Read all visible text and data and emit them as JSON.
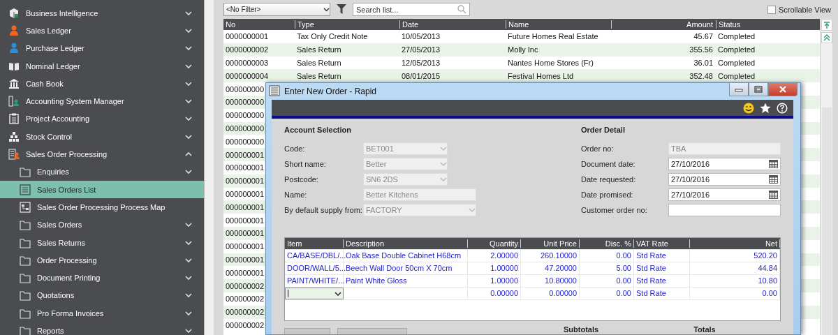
{
  "sidebar": {
    "items": [
      {
        "label": "Business Intelligence",
        "kind": "module",
        "expanded": false,
        "selected": false
      },
      {
        "label": "Sales Ledger",
        "kind": "module",
        "expanded": false,
        "selected": false
      },
      {
        "label": "Purchase Ledger",
        "kind": "module",
        "expanded": false,
        "selected": false
      },
      {
        "label": "Nominal Ledger",
        "kind": "module",
        "expanded": false,
        "selected": false
      },
      {
        "label": "Cash Book",
        "kind": "module",
        "expanded": false,
        "selected": false
      },
      {
        "label": "Accounting System Manager",
        "kind": "module",
        "expanded": false,
        "selected": false
      },
      {
        "label": "Project Accounting",
        "kind": "module",
        "expanded": false,
        "selected": false
      },
      {
        "label": "Stock Control",
        "kind": "module",
        "expanded": false,
        "selected": false
      },
      {
        "label": "Sales Order Processing",
        "kind": "module",
        "expanded": true,
        "selected": false,
        "children": [
          {
            "label": "Enquiries",
            "kind": "folder",
            "expanded": false,
            "selected": false
          },
          {
            "label": "Sales Orders List",
            "kind": "list",
            "selected": true
          },
          {
            "label": "Sales Order Processing Process Map",
            "kind": "map",
            "selected": false
          },
          {
            "label": "Sales Orders",
            "kind": "folder",
            "expanded": false,
            "selected": false
          },
          {
            "label": "Sales Returns",
            "kind": "folder",
            "expanded": false,
            "selected": false
          },
          {
            "label": "Order Processing",
            "kind": "folder",
            "expanded": false,
            "selected": false
          },
          {
            "label": "Document Printing",
            "kind": "folder",
            "expanded": false,
            "selected": false
          },
          {
            "label": "Quotations",
            "kind": "folder",
            "expanded": false,
            "selected": false
          },
          {
            "label": "Pro Forma Invoices",
            "kind": "folder",
            "expanded": false,
            "selected": false
          },
          {
            "label": "Reports",
            "kind": "folder",
            "expanded": false,
            "selected": false
          }
        ]
      }
    ]
  },
  "toolbar": {
    "filter": "<No Filter>",
    "search": {
      "placeholder": "Search list..."
    },
    "scrollable_view": {
      "label": "Scrollable View",
      "checked": false
    }
  },
  "table": {
    "columns": [
      "No",
      "Type",
      "Date",
      "Name",
      "Amount",
      "Status"
    ],
    "rows": [
      {
        "cells": [
          "0000000001",
          "Tax Only Credit Note",
          "10/05/2013",
          "Future Homes Real Estate",
          "45.67",
          "Completed"
        ]
      },
      {
        "cells": [
          "0000000002",
          "Sales Return",
          "27/05/2013",
          "Molly Inc",
          "355.56",
          "Completed"
        ]
      },
      {
        "cells": [
          "0000000003",
          "Sales Return",
          "12/05/2013",
          "Nantes Home Stores (Fr)",
          "36.01",
          "Completed"
        ]
      },
      {
        "cells": [
          "0000000004",
          "Sales Return",
          "08/01/2015",
          "Festival Homes Ltd",
          "352.48",
          "Completed"
        ]
      },
      {
        "cells": [
          "000000000"
        ]
      },
      {
        "cells": [
          "000000000"
        ]
      },
      {
        "cells": [
          "000000000"
        ]
      },
      {
        "cells": [
          "000000000"
        ]
      },
      {
        "cells": [
          "000000000"
        ]
      },
      {
        "cells": [
          "000000001"
        ]
      },
      {
        "cells": [
          "000000001"
        ]
      },
      {
        "cells": [
          "000000001"
        ]
      },
      {
        "cells": [
          "000000001"
        ]
      },
      {
        "cells": [
          "000000001"
        ]
      },
      {
        "cells": [
          "000000001"
        ]
      },
      {
        "cells": [
          "000000001"
        ]
      },
      {
        "cells": [
          "000000001"
        ]
      },
      {
        "cells": [
          "000000001"
        ]
      },
      {
        "cells": [
          "000000001"
        ]
      },
      {
        "cells": [
          "000000002"
        ]
      },
      {
        "cells": [
          "000000002"
        ]
      },
      {
        "cells": [
          "000000002"
        ]
      },
      {
        "cells": [
          "000000002"
        ]
      }
    ]
  },
  "dialog": {
    "title": "Enter New Order - Rapid",
    "account_selection": {
      "heading": "Account Selection",
      "fields": [
        {
          "label": "Code:",
          "value": "BET001",
          "kind": "combo",
          "disabled": true
        },
        {
          "label": "Short name:",
          "value": "Better",
          "kind": "combo",
          "disabled": true
        },
        {
          "label": "Postcode:",
          "value": "SN6 2DS",
          "kind": "combo",
          "disabled": true
        },
        {
          "label": "Name:",
          "value": "Better Kitchens",
          "kind": "text",
          "disabled": true
        },
        {
          "label": "By default supply from:",
          "value": "FACTORY",
          "kind": "combo",
          "disabled": true
        }
      ]
    },
    "order_detail": {
      "heading": "Order Detail",
      "fields": [
        {
          "label": "Order no:",
          "value": "TBA",
          "kind": "text",
          "disabled": true
        },
        {
          "label": "Document date:",
          "value": "27/10/2016",
          "kind": "date",
          "disabled": false
        },
        {
          "label": "Date requested:",
          "value": "27/10/2016",
          "kind": "date",
          "disabled": false
        },
        {
          "label": "Date promised:",
          "value": "27/10/2016",
          "kind": "date",
          "disabled": false
        },
        {
          "label": "Customer order no:",
          "kind": "text",
          "disabled": false
        }
      ]
    },
    "lines": {
      "columns": [
        "Item",
        "Description",
        "Quantity",
        "Unit Price",
        "Disc. %",
        "VAT Rate",
        "Net"
      ],
      "rows": [
        {
          "cells": [
            "CA/BASE/DBL/...",
            "Oak Base Double Cabinet H68cm",
            "2.00000",
            "260.10000",
            "0.00",
            "Std Rate",
            "520.20"
          ]
        },
        {
          "cells": [
            "DOOR/WALL/5...",
            "Beech Wall Door 50cm X 70cm",
            "1.00000",
            "47.20000",
            "5.00",
            "Std Rate",
            "44.84"
          ]
        },
        {
          "cells": [
            "PAINT/WHITE/...",
            "Paint White Gloss",
            "1.00000",
            "10.80000",
            "0.00",
            "Std Rate",
            "10.80"
          ]
        }
      ],
      "entry_row": {
        "cells": [
          "0.00000",
          "0.00000",
          "0.00",
          "Std Rate",
          "0.00"
        ]
      }
    },
    "subtotals_label": "Subtotals",
    "totals_label": "Totals"
  }
}
